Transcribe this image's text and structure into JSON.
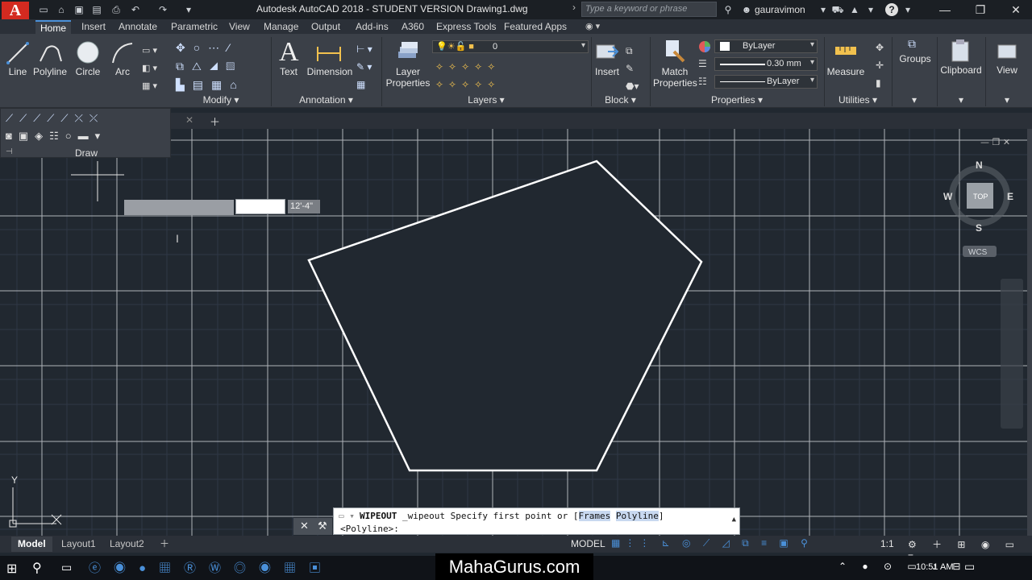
{
  "app": {
    "title": "Autodesk AutoCAD 2018 - STUDENT VERSION   Drawing1.dwg",
    "logo": "A",
    "search_placeholder": "Type a keyword or phrase",
    "user": "gauravimon"
  },
  "ribbon_tabs": [
    "Home",
    "Insert",
    "Annotate",
    "Parametric",
    "View",
    "Manage",
    "Output",
    "Add-ins",
    "A360",
    "Express Tools",
    "Featured Apps"
  ],
  "draw_panel": {
    "buttons": [
      "Line",
      "Polyline",
      "Circle",
      "Arc"
    ],
    "title": "Draw"
  },
  "modify_panel": {
    "title": "Modify"
  },
  "annotation_panel": {
    "buttons": [
      "Text",
      "Dimension"
    ],
    "title": "Annotation"
  },
  "layers_panel": {
    "button": "Layer\nProperties",
    "layer_value": "0",
    "title": "Layers"
  },
  "block_panel": {
    "button": "Insert",
    "title": "Block"
  },
  "properties_panel": {
    "button": "Match\nProperties",
    "color": "ByLayer",
    "lineweight": "0.30 mm",
    "linetype": "ByLayer",
    "title": "Properties"
  },
  "utilities_panel": {
    "button": "Measure",
    "title": "Utilities"
  },
  "groups_panel": {
    "button": "Groups"
  },
  "clipboard_panel": {
    "button": "Clipboard"
  },
  "view_panel": {
    "button": "View"
  },
  "viewcube": {
    "n": "N",
    "s": "S",
    "e": "E",
    "w": "W",
    "top": "TOP",
    "wcs": "WCS"
  },
  "dynamic_input": {
    "dimension": "12'-4\""
  },
  "ucs": {
    "y": "Y",
    "x": "X"
  },
  "command_line": {
    "line1_cmd": "WIPEOUT",
    "line1_rest": "_wipeout Specify first point or [",
    "opt1": "Frames",
    "opt2": "Polyline",
    "line1_end": "]",
    "line2": "<Polyline>:"
  },
  "layout_tabs": [
    "Model",
    "Layout1",
    "Layout2"
  ],
  "status": {
    "model": "MODEL",
    "scale": "1:1"
  },
  "taskbar": {
    "time": "10:51 AM"
  },
  "watermark": "MahaGurus.com",
  "colors": {
    "canvas": "#212830",
    "ribbon": "#3b4048",
    "accent": "#4a90d9",
    "logo": "#d42a20"
  }
}
